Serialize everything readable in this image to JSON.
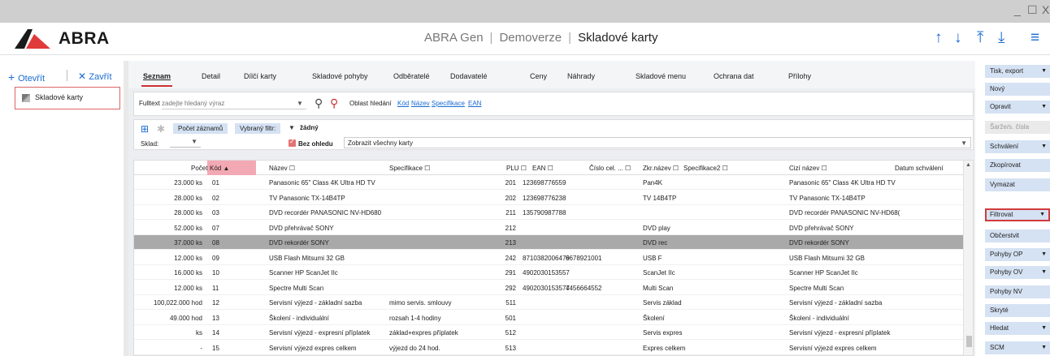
{
  "app": {
    "logo_text": "ABRA",
    "title_parts": [
      "ABRA Gen",
      "Demoverze",
      "Skladové karty"
    ]
  },
  "window_controls": [
    "_",
    "☐",
    "X"
  ],
  "header_icons": [
    "arrow-up-icon",
    "arrow-down-icon",
    "arrow-top-icon",
    "arrow-bottom-icon",
    "menu-icon"
  ],
  "left": {
    "open_label": "Otevřít",
    "close_label": "Zavřít",
    "card_label": "Skladové karty"
  },
  "tabs": [
    "Seznam",
    "Detail",
    "Dílčí karty",
    "Skladové pohyby",
    "Odběratelé",
    "Dodavatelé",
    "Ceny",
    "Náhrady",
    "Skladové menu",
    "Ochrana dat",
    "Přílohy"
  ],
  "search": {
    "label": "Fulltext",
    "placeholder": "zadejte hledaný výraz",
    "area_label": "Oblast hledání",
    "links": [
      "Kód",
      "Název",
      "Specifikace",
      "EAN"
    ]
  },
  "filter": {
    "count_button": "Počet záznamů",
    "selected_filter_label": "Vybraný filtr:",
    "selected_filter_value": "žádný",
    "sklad_label": "Sklad:",
    "bez_ohledu_label": "Bez ohledu",
    "bez_ohledu_checked": true,
    "show_value": "Zobrazit všechny karty"
  },
  "grid": {
    "columns": [
      "Počet",
      "Kód ▲",
      "Název ☐",
      "Specifikace ☐",
      "PLU ☐",
      "EAN ☐",
      "Číslo cel. ... ☐",
      "Zkr.název ☐",
      "Specifikace2 ☐",
      "Cizí název ☐",
      "Datum schválení"
    ],
    "rows": [
      {
        "pocet": "23.000 ks",
        "kod": "01",
        "nazev": "Panasonic 65\" Class 4K Ultra HD TV",
        "spec": "",
        "plu": "201",
        "ean": "123698776559",
        "cislo": "",
        "zkr": "Pan4K",
        "spec2": "",
        "cizi": "Panasonic 65\" Class 4K Ultra HD TV"
      },
      {
        "pocet": "28.000 ks",
        "kod": "02",
        "nazev": "TV Panasonic TX-14B4TP",
        "spec": "",
        "plu": "202",
        "ean": "123698776238",
        "cislo": "",
        "zkr": "TV 14B4TP",
        "spec2": "",
        "cizi": "TV Panasonic TX-14B4TP"
      },
      {
        "pocet": "28.000 ks",
        "kod": "03",
        "nazev": "DVD recordér PANASONIC NV-HD680",
        "spec": "",
        "plu": "211",
        "ean": "135790987788",
        "cislo": "",
        "zkr": "",
        "spec2": "",
        "cizi": "DVD recordér PANASONIC NV-HD68("
      },
      {
        "pocet": "52.000 ks",
        "kod": "07",
        "nazev": "DVD přehrávač SONY",
        "spec": "",
        "plu": "212",
        "ean": "",
        "cislo": "",
        "zkr": "DVD play",
        "spec2": "",
        "cizi": "DVD přehrávač SONY"
      },
      {
        "pocet": "37.000 ks",
        "kod": "08",
        "nazev": "DVD rekordér SONY",
        "spec": "",
        "plu": "213",
        "ean": "",
        "cislo": "",
        "zkr": "DVD rec",
        "spec2": "",
        "cizi": "DVD rekordér SONY",
        "selected": true
      },
      {
        "pocet": "12.000 ks",
        "kod": "09",
        "nazev": "USB Flash Mitsumi 32 GB",
        "spec": "",
        "plu": "242",
        "ean": "8710382006479",
        "cislo": "6678921001",
        "zkr": "USB F",
        "spec2": "",
        "cizi": "USB Flash Mitsumi 32 GB"
      },
      {
        "pocet": "16.000 ks",
        "kod": "10",
        "nazev": "Scanner HP ScanJet IIc",
        "spec": "",
        "plu": "291",
        "ean": "4902030153557",
        "cislo": "",
        "zkr": "ScanJet IIc",
        "spec2": "",
        "cizi": "Scanner HP ScanJet IIc"
      },
      {
        "pocet": "12.000 ks",
        "kod": "11",
        "nazev": "Spectre Multi Scan",
        "spec": "",
        "plu": "292",
        "ean": "4902030153577",
        "cislo": "4456664552",
        "zkr": "Multi Scan",
        "spec2": "",
        "cizi": "Spectre Multi Scan"
      },
      {
        "pocet": "100,022.000 hod",
        "kod": "12",
        "nazev": "Servisní výjezd - základní sazba",
        "spec": "mimo servis. smlouvy",
        "plu": "511",
        "ean": "",
        "cislo": "",
        "zkr": "Servis základ",
        "spec2": "",
        "cizi": "Servisní výjezd - základní sazba"
      },
      {
        "pocet": "49.000 hod",
        "kod": "13",
        "nazev": "Školení - individuální",
        "spec": "rozsah 1-4 hodiny",
        "plu": "501",
        "ean": "",
        "cislo": "",
        "zkr": "Školení",
        "spec2": "",
        "cizi": "Školení - individuální"
      },
      {
        "pocet": "ks",
        "kod": "14",
        "nazev": "Servisní výjezd - expresní příplatek",
        "spec": "základ+expres příplatek",
        "plu": "512",
        "ean": "",
        "cislo": "",
        "zkr": "Servis expres",
        "spec2": "",
        "cizi": "Servisní výjezd - expresní příplatek"
      },
      {
        "pocet": "-",
        "kod": "15",
        "nazev": "Servisní výjezd expres celkem",
        "spec": "výjezd do 24 hod.",
        "plu": "513",
        "ean": "",
        "cislo": "",
        "zkr": "Expres celkem",
        "spec2": "",
        "cizi": "Servisní výjezd expres celkem"
      }
    ]
  },
  "right": {
    "buttons": [
      {
        "label": "Tisk, export",
        "dd": true
      },
      {
        "label": "Nový",
        "dd": false
      },
      {
        "label": "Opravit",
        "dd": true
      },
      {
        "label": "Šarže/s. čísla",
        "dd": false,
        "disabled": true
      },
      {
        "label": "Schválení",
        "dd": true
      },
      {
        "label": "Zkopírovat",
        "dd": false
      },
      {
        "label": "Vymazat",
        "dd": false
      },
      {
        "label": "Filtrovat",
        "dd": true,
        "highlight": true
      },
      {
        "label": "Občerstvit",
        "dd": false
      },
      {
        "label": "Pohyby OP",
        "dd": true
      },
      {
        "label": "Pohyby OV",
        "dd": true
      },
      {
        "label": "Pohyby NV",
        "dd": false
      },
      {
        "label": "Skryté",
        "dd": false
      },
      {
        "label": "Hledat",
        "dd": true
      },
      {
        "label": "SCM",
        "dd": true
      }
    ]
  },
  "colors": {
    "accent": "#1a6bd1",
    "sort_col": "#f3a9b3",
    "button": "#d5e2f3",
    "highlight": "#d23b3b",
    "selected_row": "#a9a9a9"
  }
}
